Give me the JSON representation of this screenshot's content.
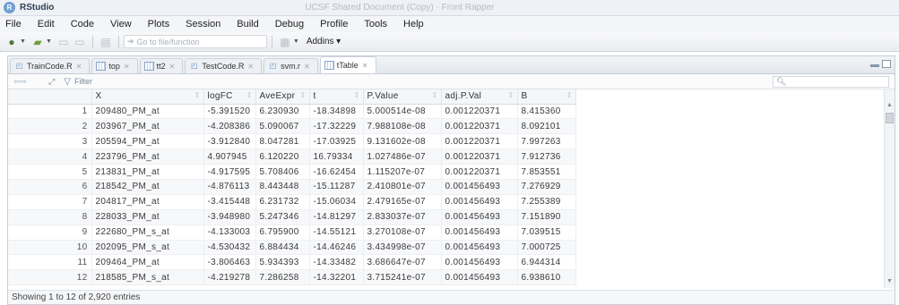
{
  "window": {
    "title": "RStudio",
    "ghost_title": "UCSF Shared Document (Copy) · Front Rapper",
    "logo_letter": "R"
  },
  "menu": [
    "File",
    "Edit",
    "Code",
    "View",
    "Plots",
    "Session",
    "Build",
    "Debug",
    "Profile",
    "Tools",
    "Help"
  ],
  "toolbar": {
    "goto_placeholder": "Go to file/function",
    "addins_label": "Addins ▾"
  },
  "tabs": [
    {
      "label": "TrainCode.R",
      "icon": "r-script-icon",
      "active": false
    },
    {
      "label": "top",
      "icon": "table-icon",
      "active": false
    },
    {
      "label": "tt2",
      "icon": "table-icon",
      "active": false
    },
    {
      "label": "TestCode.R",
      "icon": "r-script-icon",
      "active": false
    },
    {
      "label": "svm.r",
      "icon": "r-script-icon",
      "active": false
    },
    {
      "label": "tTable",
      "icon": "table-icon",
      "active": true
    }
  ],
  "filter": {
    "label": "Filter"
  },
  "table": {
    "columns": [
      "",
      "X",
      "logFC",
      "AveExpr",
      "t",
      "P.Value",
      "adj.P.Val",
      "B"
    ],
    "rows": [
      [
        "1",
        "209480_PM_at",
        "-5.391520",
        "6.230930",
        "-18.34898",
        "5.000514e-08",
        "0.001220371",
        "8.415360"
      ],
      [
        "2",
        "203967_PM_at",
        "-4.208386",
        "5.090067",
        "-17.32229",
        "7.988108e-08",
        "0.001220371",
        "8.092101"
      ],
      [
        "3",
        "205594_PM_at",
        "-3.912840",
        "8.047281",
        "-17.03925",
        "9.131602e-08",
        "0.001220371",
        "7.997263"
      ],
      [
        "4",
        "223796_PM_at",
        "4.907945",
        "6.120220",
        "16.79334",
        "1.027486e-07",
        "0.001220371",
        "7.912736"
      ],
      [
        "5",
        "213831_PM_at",
        "-4.917595",
        "5.708406",
        "-16.62454",
        "1.115207e-07",
        "0.001220371",
        "7.853551"
      ],
      [
        "6",
        "218542_PM_at",
        "-4.876113",
        "8.443448",
        "-15.11287",
        "2.410801e-07",
        "0.001456493",
        "7.276929"
      ],
      [
        "7",
        "204817_PM_at",
        "-3.415448",
        "6.231732",
        "-15.06034",
        "2.479165e-07",
        "0.001456493",
        "7.255389"
      ],
      [
        "8",
        "228033_PM_at",
        "-3.948980",
        "5.247346",
        "-14.81297",
        "2.833037e-07",
        "0.001456493",
        "7.151890"
      ],
      [
        "9",
        "222680_PM_s_at",
        "-4.133003",
        "6.795900",
        "-14.55121",
        "3.270108e-07",
        "0.001456493",
        "7.039515"
      ],
      [
        "10",
        "202095_PM_s_at",
        "-4.530432",
        "6.884434",
        "-14.46246",
        "3.434998e-07",
        "0.001456493",
        "7.000725"
      ],
      [
        "11",
        "209464_PM_at",
        "-3.806463",
        "5.934393",
        "-14.33482",
        "3.686647e-07",
        "0.001456493",
        "6.944314"
      ],
      [
        "12",
        "218585_PM_s_at",
        "-4.219278",
        "7.286258",
        "-14.32201",
        "3.715241e-07",
        "0.001456493",
        "6.938610"
      ]
    ]
  },
  "footer": {
    "status": "Showing 1 to 12 of 2,920 entries"
  }
}
